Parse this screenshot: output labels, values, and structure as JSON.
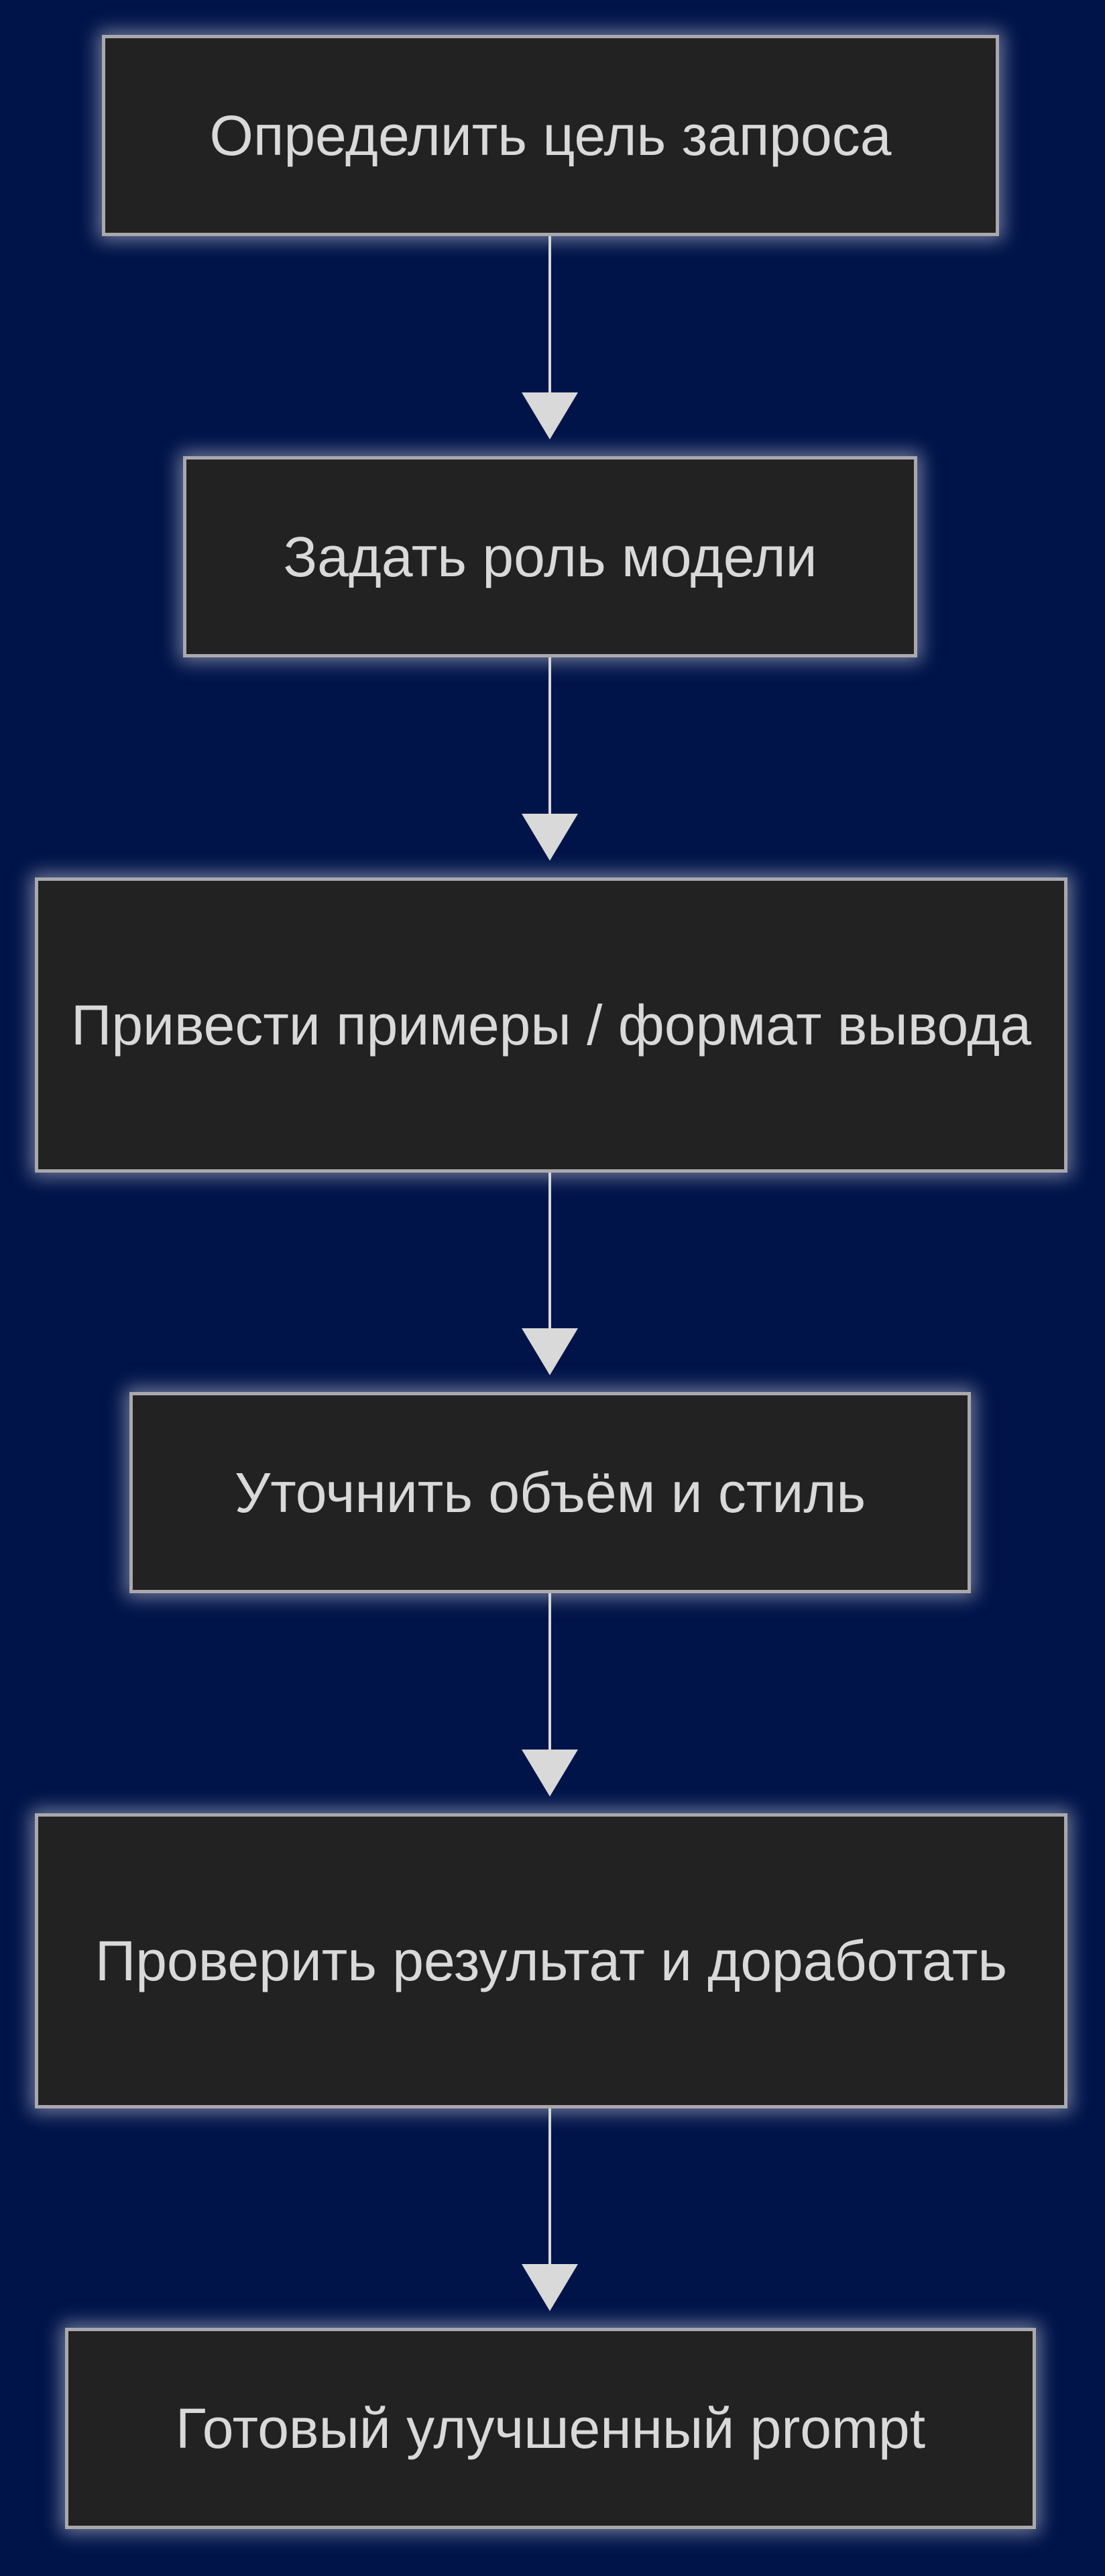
{
  "diagram": {
    "type": "flowchart",
    "direction": "top-to-bottom",
    "colors": {
      "background": "#00144a",
      "node_fill": "#222222",
      "node_border": "#a9a9ad",
      "node_text": "#d9d9d9",
      "arrow": "#d9d9d9"
    },
    "nodes": [
      {
        "id": "n1",
        "label": "Определить цель запроса"
      },
      {
        "id": "n2",
        "label": "Задать роль модели"
      },
      {
        "id": "n3",
        "label": "Привести примеры / формат вывода"
      },
      {
        "id": "n4",
        "label": "Уточнить объём и стиль"
      },
      {
        "id": "n5",
        "label": "Проверить результат и доработать"
      },
      {
        "id": "n6",
        "label": "Готовый улучшенный prompt"
      }
    ],
    "edges": [
      {
        "from": "n1",
        "to": "n2"
      },
      {
        "from": "n2",
        "to": "n3"
      },
      {
        "from": "n3",
        "to": "n4"
      },
      {
        "from": "n4",
        "to": "n5"
      },
      {
        "from": "n5",
        "to": "n6"
      }
    ]
  }
}
